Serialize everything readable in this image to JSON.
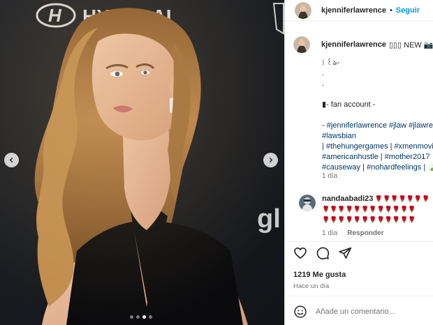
{
  "post": {
    "photo_alt": "Photo",
    "dots": [
      false,
      false,
      true,
      false
    ]
  },
  "header": {
    "username": "kjenniferlawrence",
    "separator": "•",
    "follow_label": "Seguir"
  },
  "caption": {
    "username": "kjenniferlawrence",
    "title_suffix": "▯▯▯ NEW 📷",
    "lines": [
      "⁝ ꒰ঌ-",
      ".",
      ".",
      "",
      "▮- fan account -",
      "",
      "- #jenniferlawrence #jlaw #jlawrence",
      "#lawsbian",
      "| #thehungergames | #xmenmovie",
      "#americanhustle | #mother2017",
      "#causeway | #nohardfeelings | 🍃"
    ],
    "time": "1 día"
  },
  "comment": {
    "username": "nandaabadi23",
    "username_suffix": " 🌹🌹🌹🌹🌹🌹🌹",
    "lines": [
      "🌹🌹🌹🌹🌹🌹🌹🌹🌹🌹🌹🌹",
      "🌹🌹🌹🌹🌹🌹🌹🌹🌹🌹🌹🌹"
    ],
    "time": "1 día",
    "reply_label": "Responder"
  },
  "engagement": {
    "likes": "1219 Me gusta",
    "posted": "Hace un día"
  },
  "composer": {
    "placeholder": "Añade un comentario..."
  },
  "colors": {
    "accent": "#0095f6",
    "hashtag": "#00376b",
    "muted": "#737373"
  },
  "icons": {
    "prev": "chevron-left-icon",
    "next": "chevron-right-icon",
    "like": "heart-icon",
    "comment": "comment-icon",
    "share": "share-icon",
    "emoji": "emoji-icon"
  }
}
